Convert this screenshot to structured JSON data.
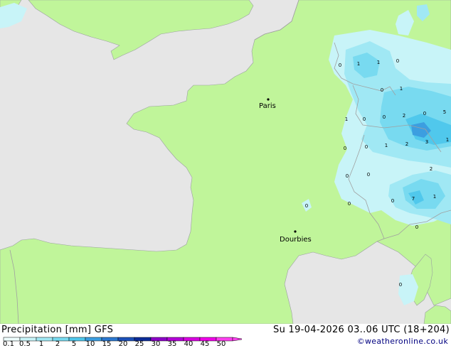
{
  "map": {
    "cities": [
      {
        "name": "Paris"
      },
      {
        "name": "Dourbies"
      }
    ],
    "point_values": [
      "0",
      "1",
      "1",
      "0",
      "0",
      "1",
      "0",
      "2",
      "0",
      "5",
      "1",
      "0",
      "0",
      "1",
      "2",
      "3",
      "1",
      "0",
      "0",
      "2",
      "0",
      "0",
      "0",
      "7",
      "1",
      "0",
      "0",
      "0"
    ]
  },
  "footer": {
    "title": "Precipitation [mm] GFS",
    "valid": "Su 19-04-2026 03..06 UTC (18+204)",
    "credit": "©weatheronline.co.uk",
    "scale": {
      "labels": [
        "0.1",
        "0.5",
        "1",
        "2",
        "5",
        "10",
        "15",
        "20",
        "25",
        "30",
        "35",
        "40",
        "45",
        "50"
      ],
      "colors": [
        "#eefefe",
        "#c8f4f8",
        "#a0e8f4",
        "#78daf0",
        "#50c8ec",
        "#3c9ee0",
        "#2c78d0",
        "#1c50b8",
        "#0c2c98",
        "#8c00c8",
        "#b400d8",
        "#d800e0",
        "#f000e8",
        "#ff40f0"
      ]
    },
    "colors": {
      "land": "#c0f59a",
      "sea": "#e6e6e6",
      "border": "#a8a8a8"
    }
  }
}
